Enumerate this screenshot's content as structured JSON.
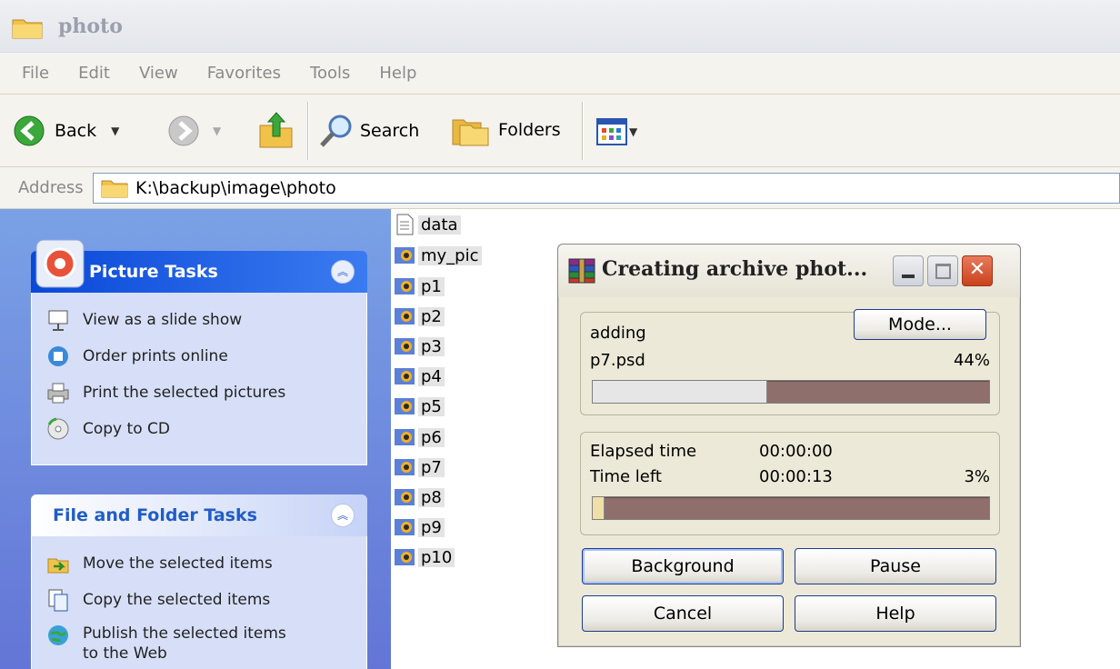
{
  "window": {
    "title": "photo"
  },
  "menu": [
    "File",
    "Edit",
    "View",
    "Favorites",
    "Tools",
    "Help"
  ],
  "toolbar": {
    "back_label": "Back",
    "search_label": "Search",
    "folders_label": "Folders"
  },
  "address": {
    "label": "Address",
    "path": "K:\\backup\\image\\photo"
  },
  "picture_tasks": {
    "title": "Picture Tasks",
    "items": [
      "View as a slide show",
      "Order prints online",
      "Print the selected pictures",
      "Copy to CD"
    ]
  },
  "file_tasks": {
    "title": "File and Folder Tasks",
    "items": [
      "Move the selected items",
      "Copy the selected items",
      "Publish the selected items",
      "to the Web"
    ]
  },
  "files": [
    "data",
    "my_pic",
    "p1",
    "p2",
    "p3",
    "p4",
    "p5",
    "p6",
    "p7",
    "p8",
    "p9",
    "p10"
  ],
  "dialog": {
    "title": "Creating archive phot...",
    "mode_label": "Mode...",
    "action": "adding",
    "current_file": "p7.psd",
    "file_percent_label": "44%",
    "file_progress": 0.44,
    "elapsed_label": "Elapsed time",
    "elapsed_value": "00:00:00",
    "left_label": "Time left",
    "left_value": "00:00:13",
    "total_percent_label": "3%",
    "total_progress": 0.03,
    "buttons": {
      "background": "Background",
      "pause": "Pause",
      "cancel": "Cancel",
      "help": "Help"
    }
  },
  "colors": {
    "task_pane_blue": "#6f8fe0",
    "progress_remaining": "#8f6f6b",
    "xp_blue": "#0a48d8"
  }
}
